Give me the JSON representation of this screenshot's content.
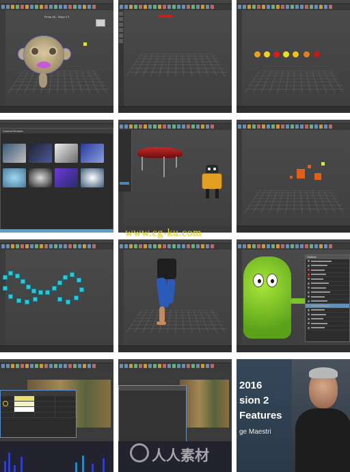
{
  "tiles": [
    {
      "name": "monkey-head-scene",
      "viewport_title": "Persp (ft) - Maya 4 3"
    },
    {
      "name": "red-car-topview-scene"
    },
    {
      "name": "colored-spheres-scene"
    },
    {
      "name": "content-browser-scene",
      "window_title": "Content Browser"
    },
    {
      "name": "car-and-robot-scene"
    },
    {
      "name": "orange-blocks-scene"
    },
    {
      "name": "cyan-cubes-scene"
    },
    {
      "name": "character-leg-scene"
    },
    {
      "name": "green-monster-scene",
      "panel_title": "Outliner"
    },
    {
      "name": "attribute-sheet-scene"
    },
    {
      "name": "empty-dialog-scene"
    },
    {
      "name": "promo-title-scene"
    }
  ],
  "promo": {
    "line1": "2016",
    "line2": "sion 2",
    "line3": "Features",
    "author": "ge Maestri"
  },
  "watermarks": {
    "site": "www.cg-ku.com",
    "brand": "人人素材"
  },
  "colors": {
    "maya_bg": "#3b3b3b",
    "selection_blue": "#5e8fbf",
    "watermark_yellow": "#f0e22a"
  }
}
